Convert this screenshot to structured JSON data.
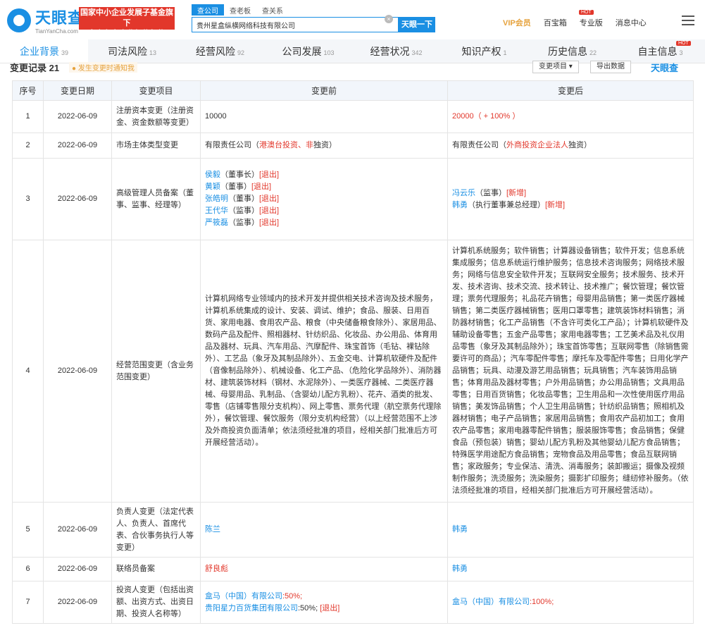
{
  "header": {
    "logo_title": "天眼查",
    "logo_sub": "TianYanCha.com",
    "badge_line1": "国家中小企业发展子基金旗下",
    "badge_line2": "官方备案企业征信机构",
    "search_tabs": [
      "查公司",
      "查老板",
      "查关系"
    ],
    "search_value": "贵州星盒纵横网络科技有限公司",
    "search_button": "天眼一下",
    "right_links": [
      "VIP会员",
      "百宝箱",
      "专业版",
      "消息中心"
    ],
    "hot_label": "HOT"
  },
  "nav": [
    {
      "label": "企业背景",
      "count": "39"
    },
    {
      "label": "司法风险",
      "count": "13"
    },
    {
      "label": "经营风险",
      "count": "92"
    },
    {
      "label": "公司发展",
      "count": "103"
    },
    {
      "label": "经营状况",
      "count": "342"
    },
    {
      "label": "知识产权",
      "count": "1"
    },
    {
      "label": "历史信息",
      "count": "22"
    },
    {
      "label": "自主信息",
      "count": "3"
    }
  ],
  "section": {
    "title": "变更记录 21",
    "tip": "● 发生变更时通知我",
    "filter": "变更项目 ▾",
    "export": "导出数据",
    "brand": "天眼查"
  },
  "table": {
    "headers": [
      "序号",
      "变更日期",
      "变更项目",
      "变更前",
      "变更后"
    ],
    "rows": [
      {
        "no": "1",
        "date": "2022-06-09",
        "item": "注册资本变更（注册资金、资金数额等变更）",
        "before": "10000",
        "after": "20000（ + 100% ）"
      },
      {
        "no": "2",
        "date": "2022-06-09",
        "item": "市场主体类型变更",
        "before_a": "有限责任公司（",
        "before_b": "港澳台投资、非",
        "before_c": "独资）",
        "after_a": "有限责任公司（",
        "after_b": "外商投资企业法人",
        "after_c": "独资）"
      },
      {
        "no": "3",
        "date": "2022-06-09",
        "item": "高级管理人员备案（董事、监事、经理等）",
        "before_list": [
          {
            "name": "侯毅",
            "role": "（董事长）",
            "tag": "[退出]"
          },
          {
            "name": "黄颖",
            "role": "（董事）",
            "tag": "[退出]"
          },
          {
            "name": "张皓明",
            "role": "（董事）",
            "tag": "[退出]"
          },
          {
            "name": "王代华",
            "role": "（监事）",
            "tag": "[退出]"
          },
          {
            "name": "严筱磊",
            "role": "（监事）",
            "tag": "[退出]"
          }
        ],
        "after_list": [
          {
            "name": "冯云乐",
            "role": "（监事）",
            "tag": "[新增]"
          },
          {
            "name": "韩勇",
            "role": "（执行董事兼总经理）",
            "tag": "[新增]"
          }
        ]
      },
      {
        "no": "4",
        "date": "2022-06-09",
        "item": "经营范围变更（含业务范围变更）",
        "before": "计算机网络专业领域内的技术开发并提供相关技术咨询及技术服务，计算机系统集成的设计、安装、调试、维护；食品、服装、日用百货、家用电器、食用农产品、粮食（中央储备粮食除外）、家居用品、数码产品及配件、照相器材、针纺织品、化妆品、办公用品、体育用品及器材、玩具、汽车用品、汽摩配件、珠宝首饰（毛钻、裸钻除外）、工艺品（象牙及其制品除外）、五金交电、计算机软硬件及配件（音像制品除外）、机械设备、化工产品、（危险化学品除外）、消防器材、建筑装饰材料（钢材、水泥除外）、一类医疗器械、二类医疗器械、母婴用品、乳制品、（含婴幼儿配方乳粉）、花卉、酒类的批发、零售（店铺零售限分支机构）、网上零售、票务代理（航空票务代理除外），餐饮管理、餐饮服务（限分支机构经营）（以上经营范围不上涉及外商投资负面清单；依法须经批准的项目，经相关部门批准后方可开展经营活动）。",
        "after": "计算机系统服务；软件销售；计算器设备销售；软件开发；信息系统集成服务；信息系统运行维护服务；信息技术咨询服务；网络技术服务；网络与信息安全软件开发；互联网安全服务；技术服务、技术开发、技术咨询、技术交流、技术转让、技术推广；餐饮管理；餐饮管理；票务代理服务；礼品花卉销售；母婴用品销售；第一类医疗器械销售；第二类医疗器械销售；医用口罩零售；建筑装饰材料销售；消防器材销售；化工产品销售（不含许可类化工产品）；计算机软硬件及辅助设备零售；五金产品零售；家用电器零售；工艺美术品及礼仪用品零售（象牙及其制品除外）；珠宝首饰零售；互联网零售（除销售需要许可的商品）；汽车零配件零售；摩托车及零配件零售；日用化学产品销售；玩具、动漫及游艺用品销售；玩具销售；汽车装饰用品销售；体育用品及器材零售；户外用品销售；办公用品销售；文具用品零售；日用百货销售；化妆品零售；卫生用品和一次性使用医疗用品销售；美发饰品销售；个人卫生用品销售；针纺织品销售；照相机及器材销售；电子产品销售；家居用品销售；食用农产品初加工；食用农产品零售；家用电器零配件销售；服装服饰零售；食品销售；保健食品（预包装）销售；婴幼儿配方乳粉及其他婴幼儿配方食品销售；特殊医学用途配方食品销售；宠物食品及用品零售；食品互联网销售；家政服务；专业保洁、清洗、消毒服务；装卸搬运；摄像及视频制作服务；洗烫服务；洗染服务；摄影扩印服务；缝纫修补服务。（依法须经批准的项目，经相关部门批准后方可开展经营活动）。"
      },
      {
        "no": "5",
        "date": "2022-06-09",
        "item": "负责人变更（法定代表人、负责人、首席代表、合伙事务执行人等变更）",
        "before": "陈兰",
        "after": "韩勇"
      },
      {
        "no": "6",
        "date": "2022-06-09",
        "item": "联络员备案",
        "before": "舒良彪",
        "after": "韩勇"
      },
      {
        "no": "7",
        "date": "2022-06-09",
        "item": "投资人变更（包括出资额、出资方式、出资日期、投资人名称等）",
        "before_l1_name": "盒马（中国）有限公司",
        "before_l1_pct": ":50%;",
        "before_l2_name": "贵阳星力百货集团有限公司",
        "before_l2_pct": ":50%;",
        "before_l2_tag": "[退出]",
        "after_l1_name": "盒马（中国）有限公司",
        "after_l1_pct": ":100%;"
      }
    ]
  }
}
